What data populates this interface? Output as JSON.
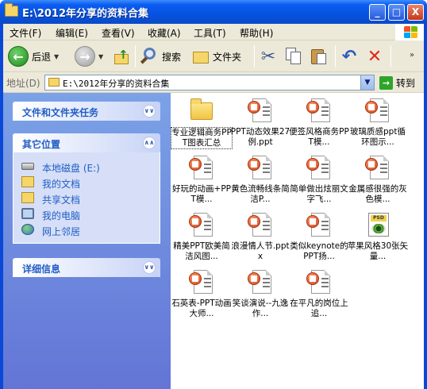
{
  "window": {
    "title": "E:\\2012年分享的资料合集",
    "controls": {
      "minimize": "_",
      "maximize": "□",
      "close": "X"
    }
  },
  "menu": [
    "文件(F)",
    "编辑(E)",
    "查看(V)",
    "收藏(A)",
    "工具(T)",
    "帮助(H)"
  ],
  "toolbar": {
    "back": "后退",
    "search": "搜索",
    "folders": "文件夹"
  },
  "address": {
    "label": "地址(D)",
    "value": "E:\\2012年分享的资料合集",
    "go": "转到"
  },
  "sidebar": {
    "tasks_title": "文件和文件夹任务",
    "other_title": "其它位置",
    "places": [
      "本地磁盘 (E:)",
      "我的文档",
      "共享文档",
      "我的电脑",
      "网上邻居"
    ],
    "details_title": "详细信息"
  },
  "files": [
    {
      "name": "专业逻辑商务PPT图表汇总",
      "type": "folder",
      "selected": true
    },
    {
      "name": "PPT动态效果27例.ppt",
      "type": "ppt"
    },
    {
      "name": "便签风格商务PPT模...",
      "type": "ppt"
    },
    {
      "name": "玻璃质感ppt循环图示...",
      "type": "ppt"
    },
    {
      "name": "好玩的动画+PPT模...",
      "type": "ppt"
    },
    {
      "name": "黄色流畅线条简洁P...",
      "type": "ppt"
    },
    {
      "name": "简单做出炫丽文字飞...",
      "type": "ppt"
    },
    {
      "name": "金属感很强的灰色模...",
      "type": "ppt"
    },
    {
      "name": "精美PPT欧美简洁风图...",
      "type": "ppt"
    },
    {
      "name": "浪漫情人节.pptx",
      "type": "ppt"
    },
    {
      "name": "类似keynote的PPT扬...",
      "type": "ppt"
    },
    {
      "name": "苹果风格30张矢量...",
      "type": "psd"
    },
    {
      "name": "石英表-PPT动画大师...",
      "type": "ppt"
    },
    {
      "name": "笑谈演说--九逸作...",
      "type": "ppt"
    },
    {
      "name": "在平凡的岗位上追...",
      "type": "ppt"
    }
  ],
  "icon_labels": {
    "psd": "PSD"
  }
}
